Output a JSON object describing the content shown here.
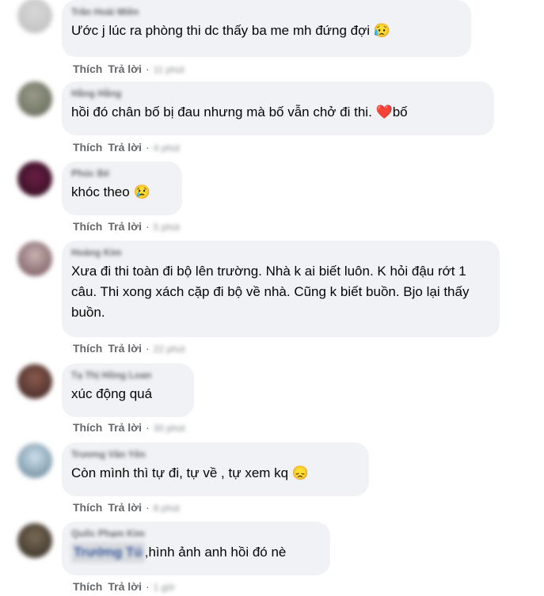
{
  "actions": {
    "like": "Thích",
    "reply": "Trả lời",
    "separator": "·"
  },
  "comments": [
    {
      "author": "Trần Hoài Miên",
      "text": "Ước j lúc ra phòng thi dc thấy ba me mh đứng đợi",
      "emoji": "😥",
      "time": "11 phút"
    },
    {
      "author": "Hằng Hằng",
      "text": "hồi đó chân bố bị đau nhưng mà bố vẫn chở đi thi.",
      "emoji": "❤️",
      "suffix": "bố",
      "time": "4 phút"
    },
    {
      "author": "Phúc Bé",
      "text": "khóc theo",
      "emoji": "😢",
      "time": "5 phút"
    },
    {
      "author": "Hoàng Kim",
      "text": "Xưa đi thi toàn đi bộ lên trường. Nhà k ai biết luôn. K hỏi đậu rớt 1 câu. Thi xong xách cặp đi bộ về nhà. Cũng k biết buồn. Bjo lại thấy buồn.",
      "time": "22 phút"
    },
    {
      "author": "Tạ Thị Hồng Loan",
      "text": "xúc động quá",
      "time": "30 phút"
    },
    {
      "author": "Trương Văn Yên",
      "text": "Còn mình thì tự đi, tự về , tự xem kq",
      "emoji": "😞",
      "time": "8 phút"
    },
    {
      "author": "Quốc Phạm Kim",
      "tag": "Trường Tú",
      "text": ",hình ảnh anh hồi đó nè",
      "time": "1 giờ"
    }
  ],
  "colors": {
    "bubble": "#f0f2f5",
    "action_text": "#65676b",
    "comment_text": "#050505"
  }
}
